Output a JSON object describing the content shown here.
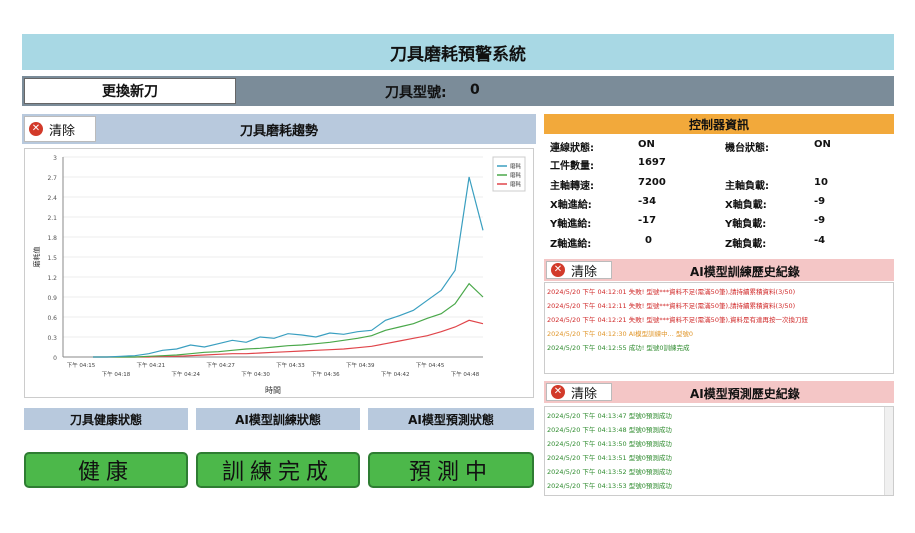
{
  "app": {
    "title": "刀具磨耗預警系統"
  },
  "toolbar": {
    "replace_label": "更換新刀",
    "model_label": "刀具型號:",
    "model_value": "0"
  },
  "chart_panel": {
    "clear_label": "清除",
    "title": "刀具磨耗趨勢"
  },
  "chart_data": {
    "type": "line",
    "title": "",
    "xlabel": "時間",
    "ylabel": "磨耗值",
    "ylim": [
      0,
      3
    ],
    "yticks": [
      "0",
      "0.3",
      "0.6",
      "0.9",
      "1.2",
      "1.5",
      "1.8",
      "2.1",
      "2.4",
      "2.7",
      "3"
    ],
    "xticks": [
      "下午 04:15",
      "下午 04:18",
      "下午 04:21",
      "下午 04:24",
      "下午 04:27",
      "下午 04:30",
      "下午 04:33",
      "下午 04:36",
      "下午 04:39",
      "下午 04:42",
      "下午 04:45",
      "下午 04:48"
    ],
    "legend": [
      "磨耗",
      "磨耗",
      "磨耗"
    ],
    "legend_position": "top-right",
    "series": [
      {
        "color": "#3a9fc0",
        "values": [
          0,
          0,
          0.01,
          0.02,
          0.05,
          0.1,
          0.12,
          0.18,
          0.15,
          0.2,
          0.25,
          0.22,
          0.3,
          0.28,
          0.35,
          0.33,
          0.3,
          0.36,
          0.34,
          0.38,
          0.4,
          0.55,
          0.62,
          0.7,
          0.85,
          1.0,
          1.3,
          2.7,
          1.9
        ]
      },
      {
        "color": "#4aa84a",
        "values": [
          0,
          0,
          0,
          0,
          0.01,
          0.02,
          0.03,
          0.05,
          0.07,
          0.08,
          0.1,
          0.12,
          0.13,
          0.15,
          0.17,
          0.18,
          0.2,
          0.22,
          0.25,
          0.28,
          0.32,
          0.4,
          0.45,
          0.5,
          0.58,
          0.65,
          0.8,
          1.1,
          0.9
        ]
      },
      {
        "color": "#e0454a",
        "values": [
          0,
          0,
          0,
          0,
          0,
          0.01,
          0.01,
          0.02,
          0.03,
          0.04,
          0.05,
          0.05,
          0.06,
          0.07,
          0.08,
          0.09,
          0.1,
          0.11,
          0.12,
          0.14,
          0.16,
          0.2,
          0.24,
          0.28,
          0.32,
          0.38,
          0.45,
          0.55,
          0.5
        ]
      }
    ]
  },
  "status": {
    "health": {
      "label": "刀具健康狀態",
      "value": "健康"
    },
    "train": {
      "label": "AI模型訓練狀態",
      "value": "訓練完成"
    },
    "predict": {
      "label": "AI模型預測狀態",
      "value": "預測中"
    }
  },
  "controller": {
    "title": "控制器資訊",
    "conn_label": "連線狀態:",
    "conn_value": "ON",
    "machine_label": "機台狀態:",
    "machine_value": "ON",
    "count_label": "工件數量:",
    "count_value": "1697",
    "speed_label": "主軸轉速:",
    "speed_value": "7200",
    "spindle_load_label": "主軸負載:",
    "spindle_load_value": "10",
    "x_feed_label": "X軸進給:",
    "x_feed_value": "-34",
    "x_load_label": "X軸負載:",
    "x_load_value": "-9",
    "y_feed_label": "Y軸進給:",
    "y_feed_value": "-17",
    "y_load_label": "Y軸負載:",
    "y_load_value": "-9",
    "z_feed_label": "Z軸進給:",
    "z_feed_value": "0",
    "z_load_label": "Z軸負載:",
    "z_load_value": "-4"
  },
  "train_log": {
    "clear_label": "清除",
    "title": "AI模型訓練歷史紀錄",
    "lines": [
      {
        "text": "2024/5/20 下午 04:12:01 失敗! 型號***資料不足(需滿50筆),請持續累積資料(3/50)",
        "color": "#d02a2a"
      },
      {
        "text": "2024/5/20 下午 04:12:11 失敗! 型號***資料不足(需滿50筆),請持續累積資料(3/50)",
        "color": "#d02a2a"
      },
      {
        "text": "2024/5/20 下午 04:12:21 失敗! 型號***資料不足(需滿50筆),資料是有達再按一次換刀鈕",
        "color": "#d02a2a"
      },
      {
        "text": "2024/5/20 下午 04:12:30 AI模型訓練中... 型號0",
        "color": "#e0962a"
      },
      {
        "text": "2024/5/20 下午 04:12:55 成功! 型號0訓練完成",
        "color": "#2e8b2e"
      }
    ]
  },
  "predict_log": {
    "clear_label": "清除",
    "title": "AI模型預測歷史紀錄",
    "lines": [
      "2024/5/20 下午 04:13:47 型號0預測成功",
      "2024/5/20 下午 04:13:48 型號0預測成功",
      "2024/5/20 下午 04:13:50 型號0預測成功",
      "2024/5/20 下午 04:13:51 型號0預測成功",
      "2024/5/20 下午 04:13:52 型號0預測成功",
      "2024/5/20 下午 04:13:53 型號0預測成功"
    ],
    "color": "#2e8b2e"
  }
}
